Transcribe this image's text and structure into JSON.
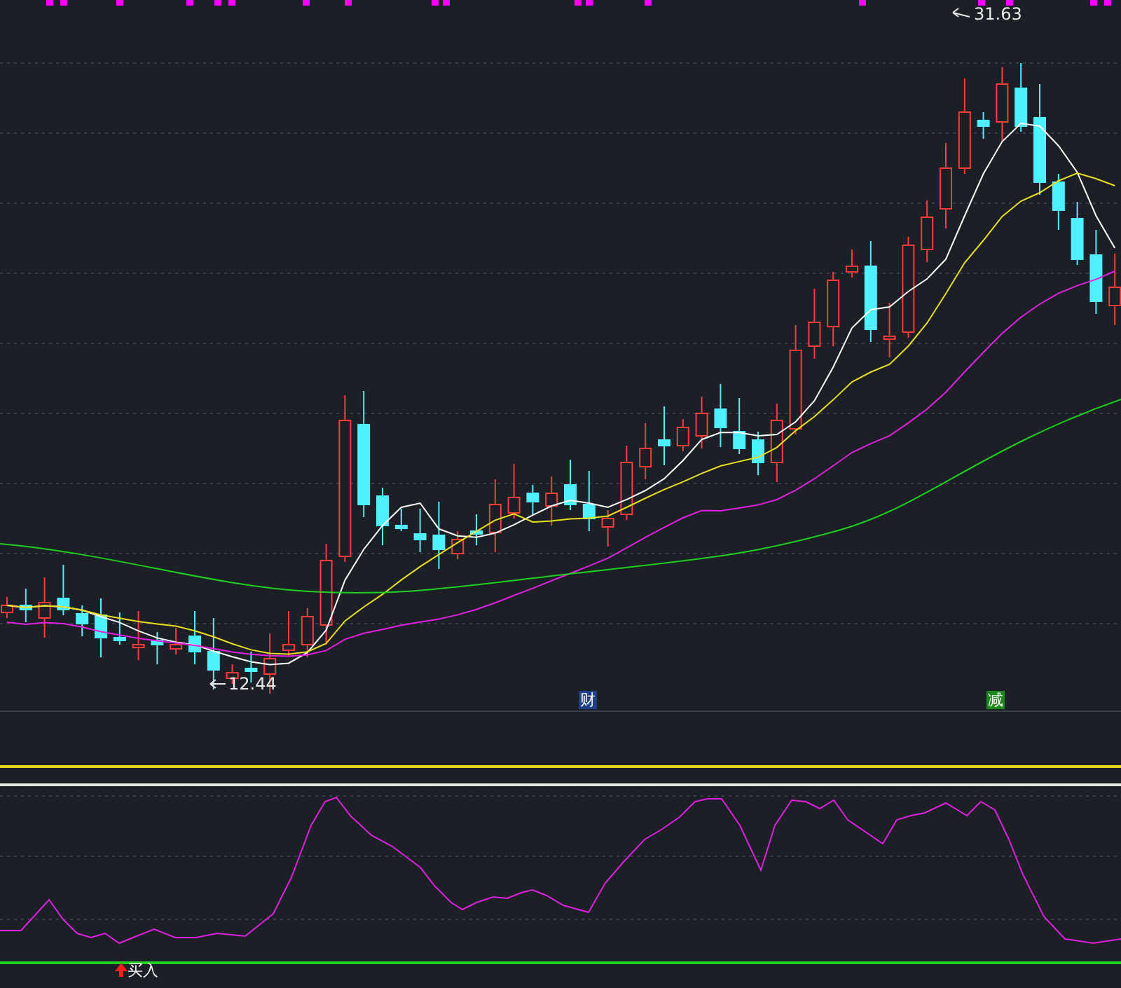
{
  "price_chart": {
    "high_label": "31.63",
    "low_label": "12.44",
    "events": [
      {
        "text": "财",
        "color": "#1d3f8a"
      },
      {
        "text": "减",
        "color": "#1a8a1a"
      }
    ]
  },
  "indicator": {
    "signal": "买入"
  }
}
